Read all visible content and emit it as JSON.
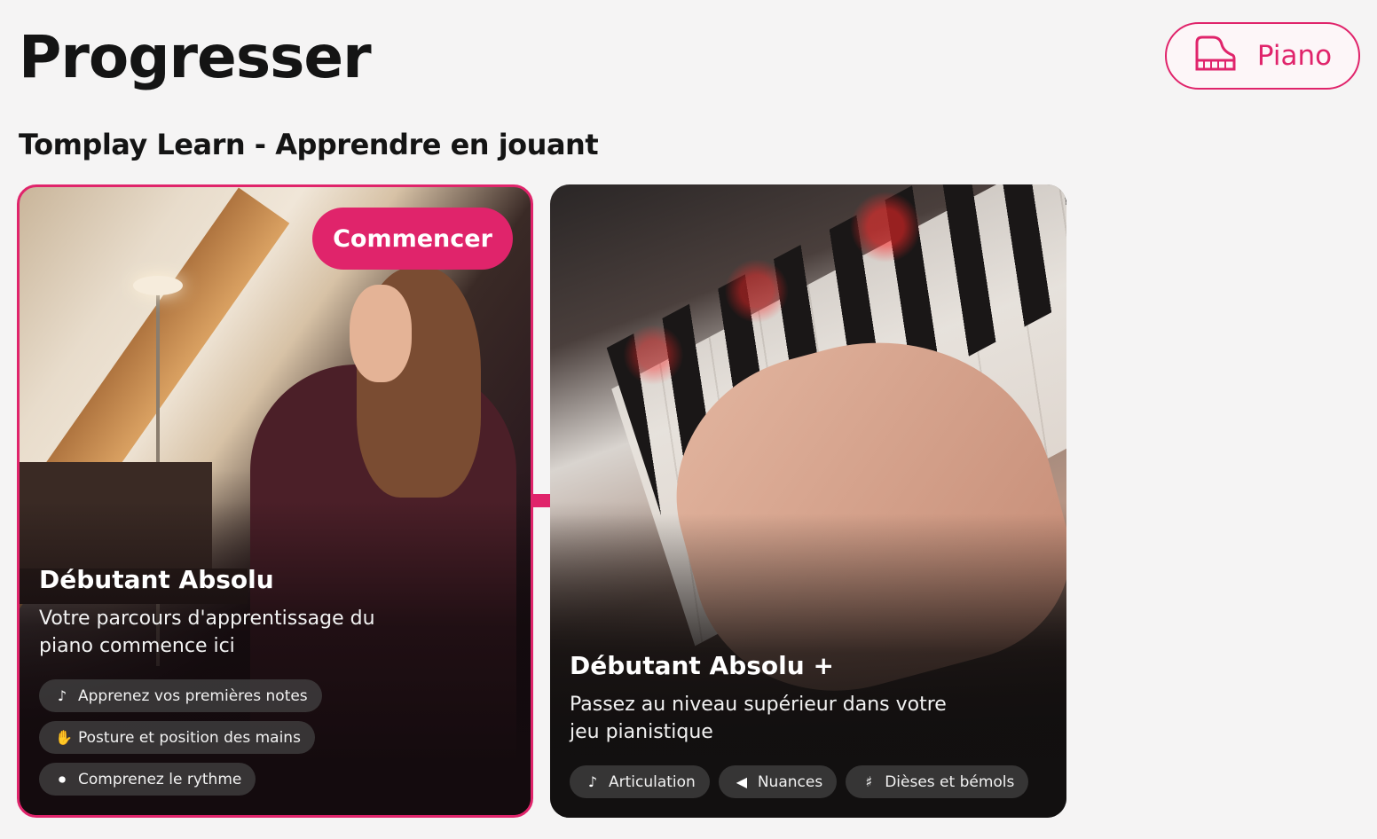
{
  "header": {
    "title": "Progresser",
    "instrument_button": {
      "label": "Piano",
      "icon": "grand-piano-icon",
      "accent": "#e0246b"
    }
  },
  "section": {
    "title": "Tomplay Learn - Apprendre en jouant"
  },
  "courses": [
    {
      "title": "Débutant Absolu",
      "description": "Votre parcours d'apprentissage du piano commence ici",
      "start_label": "Commencer",
      "selected": true,
      "tags": [
        {
          "label": "Apprenez vos premières notes",
          "icon": "music-note-icon",
          "glyph": "♪"
        },
        {
          "label": "Posture et position des mains",
          "icon": "hand-icon",
          "glyph": "✋"
        },
        {
          "label": "Comprenez le rythme",
          "icon": "rhythm-icon",
          "glyph": "⏺"
        }
      ]
    },
    {
      "title": "Débutant Absolu +",
      "description": "Passez au niveau supérieur dans votre jeu pianistique",
      "selected": false,
      "tags": [
        {
          "label": "Articulation",
          "icon": "music-note-icon",
          "glyph": "♪"
        },
        {
          "label": "Nuances",
          "icon": "dynamics-icon",
          "glyph": "◀"
        },
        {
          "label": "Dièses et bémols",
          "icon": "sharp-icon",
          "glyph": "♯"
        }
      ]
    }
  ],
  "colors": {
    "accent": "#e0246b",
    "background": "#f5f4f4"
  }
}
